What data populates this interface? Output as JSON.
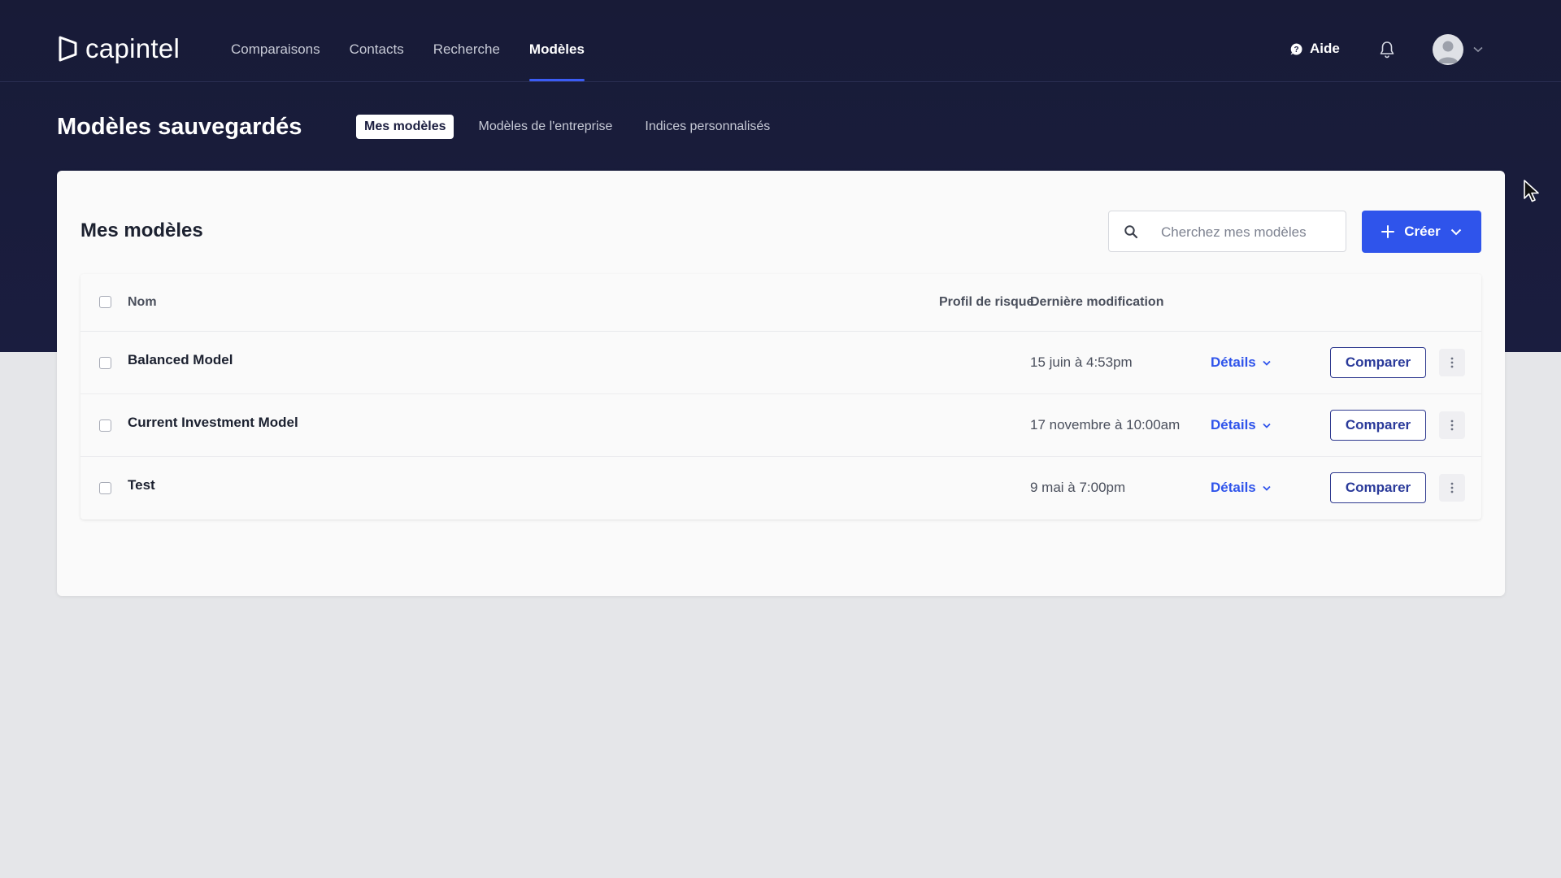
{
  "brand": {
    "name": "capintel"
  },
  "nav": {
    "links": [
      {
        "label": "Comparaisons"
      },
      {
        "label": "Contacts"
      },
      {
        "label": "Recherche"
      },
      {
        "label": "Modèles"
      }
    ],
    "active_index": 3,
    "help_label": "Aide"
  },
  "page": {
    "title": "Modèles sauvegardés",
    "tabs": [
      {
        "label": "Mes modèles"
      },
      {
        "label": "Modèles de l'entreprise"
      },
      {
        "label": "Indices personnalisés"
      }
    ],
    "active_tab": 0
  },
  "card": {
    "title": "Mes modèles",
    "search": {
      "placeholder": "Cherchez mes modèles",
      "value": ""
    },
    "create_label": "Créer"
  },
  "table": {
    "headers": {
      "name": "Nom",
      "risk": "Profil de risque",
      "modified": "Dernière modification"
    },
    "rows": [
      {
        "name": "Balanced Model",
        "risk": "",
        "modified": "15 juin à 4:53pm",
        "details": "Détails",
        "compare": "Comparer"
      },
      {
        "name": "Current Investment Model",
        "risk": "",
        "modified": "17 novembre à 10:00am",
        "details": "Détails",
        "compare": "Comparer"
      },
      {
        "name": "Test",
        "risk": "",
        "modified": "9 mai à 7:00pm",
        "details": "Détails",
        "compare": "Comparer"
      }
    ]
  },
  "colors": {
    "accent": "#2f54eb",
    "header_bg": "#1a1d3f",
    "background": "#e5e6e9"
  }
}
